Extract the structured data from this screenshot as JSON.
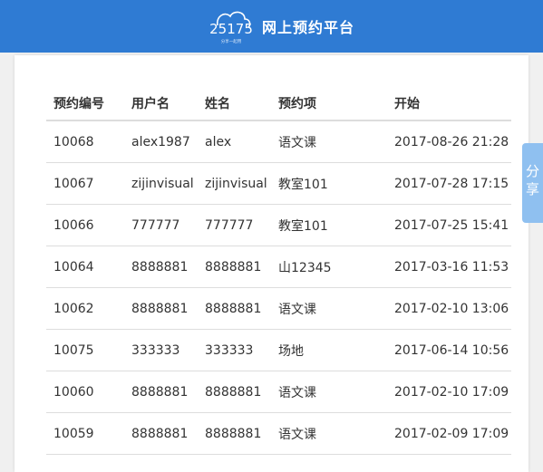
{
  "header": {
    "logo_text": "25175",
    "logo_tagline": "分享一起用",
    "title": "网上预约平台",
    "background": "#2f7bd3"
  },
  "share": {
    "char1": "分",
    "char2": "享",
    "color": "#8fc0f0"
  },
  "table": {
    "columns": [
      "预约编号",
      "用户名",
      "姓名",
      "预约项",
      "开始"
    ],
    "rows": [
      [
        "10068",
        "alex1987",
        "alex",
        "语文课",
        "2017-08-26 21:28"
      ],
      [
        "10067",
        "zijinvisual",
        "zijinvisual",
        "教室101",
        "2017-07-28 17:15"
      ],
      [
        "10066",
        "777777",
        "777777",
        "教室101",
        "2017-07-25 15:41"
      ],
      [
        "10064",
        "8888881",
        "8888881",
        "山12345",
        "2017-03-16 11:53"
      ],
      [
        "10062",
        "8888881",
        "8888881",
        "语文课",
        "2017-02-10 13:06"
      ],
      [
        "10075",
        "333333",
        "333333",
        "场地",
        "2017-06-14 10:56"
      ],
      [
        "10060",
        "8888881",
        "8888881",
        "语文课",
        "2017-02-10 17:09"
      ],
      [
        "10059",
        "8888881",
        "8888881",
        "语文课",
        "2017-02-09 17:09"
      ]
    ]
  }
}
